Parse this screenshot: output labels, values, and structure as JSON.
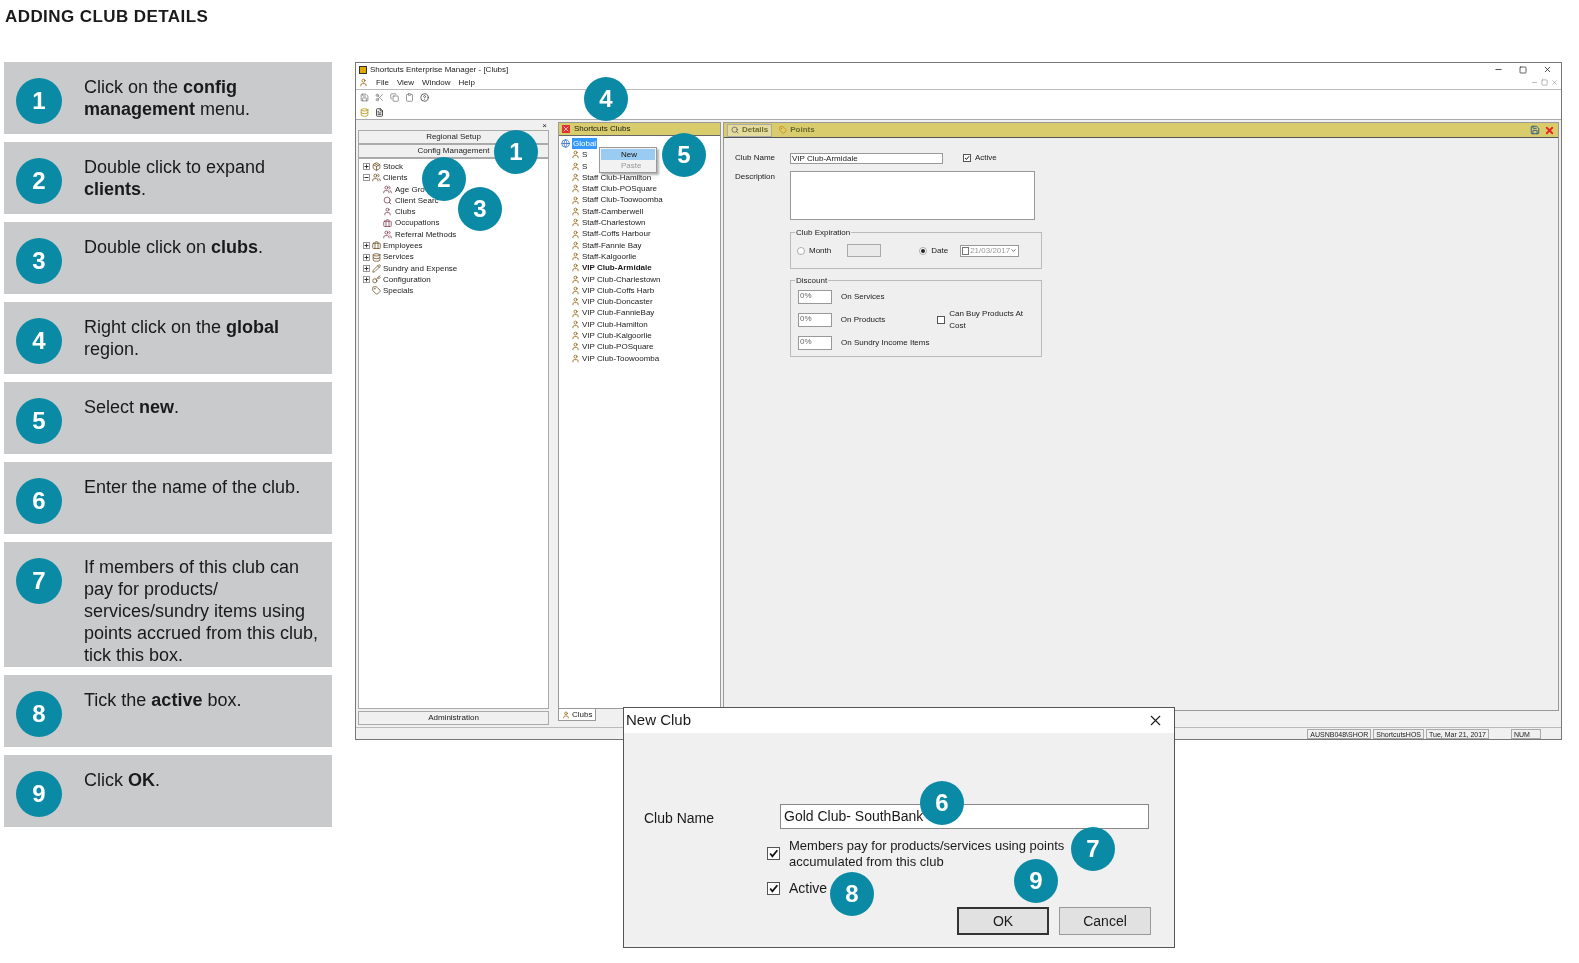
{
  "page_title": "ADDING CLUB DETAILS",
  "steps": [
    {
      "number": "1",
      "text": "Click on the **config management** menu."
    },
    {
      "number": "2",
      "text": "Double click to expand **clients**."
    },
    {
      "number": "3",
      "text": "Double click on **clubs**."
    },
    {
      "number": "4",
      "text": "Right click on the **global** region."
    },
    {
      "number": "5",
      "text": "Select **new**."
    },
    {
      "number": "6",
      "text": "Enter the name of the club."
    },
    {
      "number": "7",
      "text": "If members of this club can pay for products/ services/sundry items using points accrued from this club, tick this box."
    },
    {
      "number": "8",
      "text": "Tick the **active** box."
    },
    {
      "number": "9",
      "text": "Click **OK**."
    }
  ],
  "app": {
    "title": "Shortcuts Enterprise Manager - [Clubs]",
    "menu": [
      "File",
      "View",
      "Window",
      "Help"
    ],
    "left_pane": {
      "close": "×",
      "buttons": [
        "Regional Setup",
        "Config Management"
      ],
      "footer": "Administration",
      "tree": [
        {
          "label": "Stock",
          "has_children": true,
          "expanded": false
        },
        {
          "label": "Clients",
          "has_children": true,
          "expanded": true,
          "children": [
            {
              "label": "Age Gro"
            },
            {
              "label": "Client Searc"
            },
            {
              "label": "Clubs"
            },
            {
              "label": "Occupations"
            },
            {
              "label": "Referral Methods"
            }
          ]
        },
        {
          "label": "Employees",
          "has_children": true,
          "expanded": false
        },
        {
          "label": "Services",
          "has_children": true,
          "expanded": false
        },
        {
          "label": "Sundry and Expense",
          "has_children": true,
          "expanded": false
        },
        {
          "label": "Configuration",
          "has_children": true,
          "expanded": false
        },
        {
          "label": "Specials",
          "has_children": false,
          "expanded": false
        }
      ]
    },
    "clubs_pane": {
      "header": "Shortcuts Clubs",
      "root": {
        "label": "Global",
        "selected": true
      },
      "tab": "Clubs",
      "items": [
        {
          "label": "S",
          "current": false
        },
        {
          "label": "S",
          "current": false
        },
        {
          "label": "Staff Club-Hamilton",
          "current": false
        },
        {
          "label": "Staff Club-POSquare",
          "current": false
        },
        {
          "label": "Staff Club-Toowoomba",
          "current": false
        },
        {
          "label": "Staff-Camberwell",
          "current": false
        },
        {
          "label": "Staff-Charlestown",
          "current": false
        },
        {
          "label": "Staff-Coffs Harbour",
          "current": false
        },
        {
          "label": "Staff-Fannie Bay",
          "current": false
        },
        {
          "label": "Staff-Kalgoorlie",
          "current": false
        },
        {
          "label": "VIP Club-Armidale",
          "current": true
        },
        {
          "label": "VIP Club-Charlestown",
          "current": false
        },
        {
          "label": "VIP Club-Coffs Harb",
          "current": false
        },
        {
          "label": "VIP Club-Doncaster",
          "current": false
        },
        {
          "label": "VIP Club-FannieBay",
          "current": false
        },
        {
          "label": "VIP Club-Hamilton",
          "current": false
        },
        {
          "label": "VIP Club-Kalgoorlie",
          "current": false
        },
        {
          "label": "VIP Club-POSquare",
          "current": false
        },
        {
          "label": "VIP Club-Toowoomba",
          "current": false
        }
      ]
    },
    "context_menu": [
      {
        "label": "New",
        "highlighted": true,
        "disabled": false
      },
      {
        "label": "Paste",
        "highlighted": false,
        "disabled": true
      }
    ],
    "details": {
      "tabs": [
        {
          "label": "Details",
          "selected": true
        },
        {
          "label": "Points",
          "selected": false
        }
      ],
      "club_name_label": "Club Name",
      "club_name": "VIP Club-Armidale",
      "active_label": "Active",
      "active": true,
      "description_label": "Description",
      "expiration": {
        "title": "Club Expiration",
        "month_label": "Month",
        "month_selected": false,
        "date_label": "Date",
        "date_selected": true,
        "date": "21/03/2017"
      },
      "discount": {
        "title": "Discount",
        "rows": [
          {
            "value": "0%",
            "label": "On Services"
          },
          {
            "value": "0%",
            "label": "On Products"
          },
          {
            "value": "0%",
            "label": "On Sundry Income Items"
          }
        ],
        "cost_label": "Can Buy Products At Cost",
        "cost_checked": false
      }
    },
    "status_bar": [
      "AUSNB048\\SHOR",
      "ShortcutsHOS",
      "Tue, Mar 21, 2017",
      "NUM"
    ]
  },
  "dialog": {
    "title": "New Club",
    "club_name_label": "Club Name",
    "club_name": "Gold Club- SouthBank",
    "points_label": "Members pay for products/services using points accumulated from this club",
    "points_checked": true,
    "active_label": "Active",
    "active": true,
    "buttons": [
      "OK",
      "Cancel"
    ]
  },
  "callouts": [
    "1",
    "2",
    "3",
    "4",
    "5",
    "6",
    "7",
    "8",
    "9"
  ]
}
